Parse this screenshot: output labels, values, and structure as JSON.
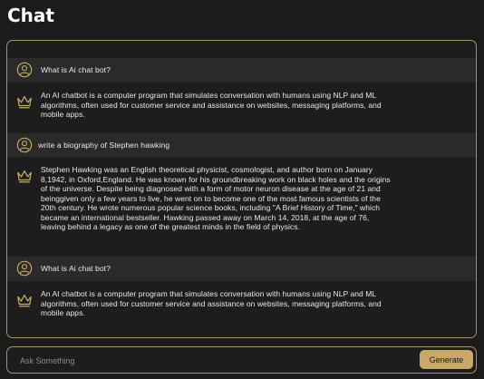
{
  "page": {
    "title": "Chat"
  },
  "messages": [
    {
      "role": "user",
      "icon": "user-icon",
      "text": "What is Ai chat bot?"
    },
    {
      "role": "bot",
      "icon": "crown-icon",
      "text": "An AI chatbot is a computer program that simulates conversation with humans using NLP and ML algorithms, often used for customer service and assistance on websites, messaging platforms, and mobile apps."
    },
    {
      "role": "user",
      "icon": "user-icon",
      "text": "write a biography of Stephen hawking"
    },
    {
      "role": "bot",
      "icon": "crown-icon",
      "text": "Stephen Hawking was an English theoretical physicist, cosmologist, and author born on January 8,1942, in Oxford,England. He was known for his groundbreaking work on black holes and the origins of the universe. Despite being diagnosed with a form of motor neuron disease at the age of 21 and beinggiven only a few years to live, he went on to become one of the most famous scientists of the 20th century. He wrote numerous popular science books, including \"A Brief History of Time,\" which became an international bestseller. Hawking passed away on March 14, 2018, at the age of 76, leaving behind a legacy as one of the greatest minds in the field of physics."
    },
    {
      "role": "user",
      "icon": "user-icon",
      "text": "What is Ai chat bot?"
    },
    {
      "role": "bot",
      "icon": "crown-icon",
      "text": "An AI chatbot is a computer program that simulates conversation with humans using NLP and ML algorithms, often used for customer service and assistance on websites, messaging platforms, and mobile apps."
    }
  ],
  "input": {
    "placeholder": "Ask Something",
    "value": ""
  },
  "generate_button": {
    "label": "Generate"
  },
  "colors": {
    "accent": "#c9a86a",
    "border": "#a8926a",
    "background": "#1b1b1b",
    "user_row": "#2a2a2a"
  }
}
